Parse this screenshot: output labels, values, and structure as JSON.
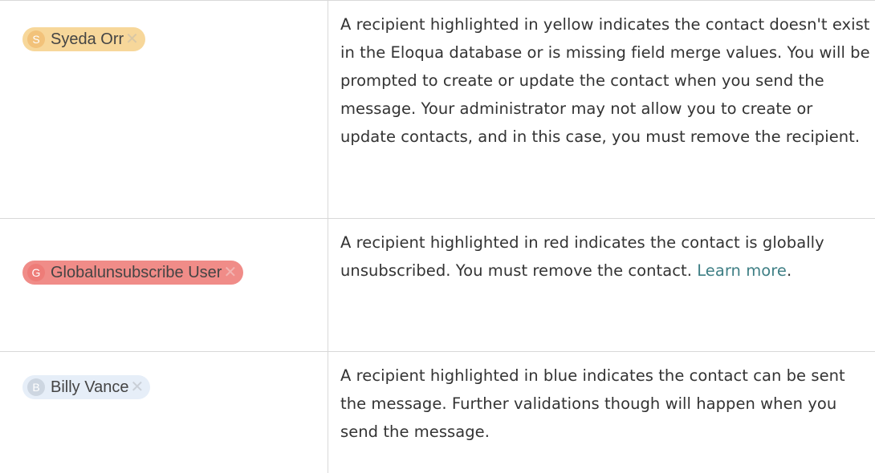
{
  "rows": [
    {
      "chip": {
        "initial": "S",
        "name": "Syeda Orr",
        "close": "✕"
      },
      "description": "A recipient highlighted in yellow indicates the contact doesn't exist in the Eloqua database or is missing field merge values. You will be prompted to create or update the contact when you send the message. Your administrator may not allow you to create or update contacts, and in this case, you must remove the recipient."
    },
    {
      "chip": {
        "initial": "G",
        "name": "Globalunsubscribe User",
        "close": "✕"
      },
      "description": "A recipient highlighted in red indicates the contact is globally unsubscribed. You must remove the contact.",
      "link_text": "Learn more",
      "after_link": "."
    },
    {
      "chip": {
        "initial": "B",
        "name": "Billy Vance",
        "close": "✕"
      },
      "description": "A recipient highlighted in blue indicates the contact can be sent the message. Further validations though will happen when you send the message."
    }
  ],
  "colors": {
    "yellow_chip": "#f7d79a",
    "red_chip": "#f08c88",
    "blue_chip": "#e6eef8",
    "link": "#3f7f85",
    "text": "#333333"
  }
}
